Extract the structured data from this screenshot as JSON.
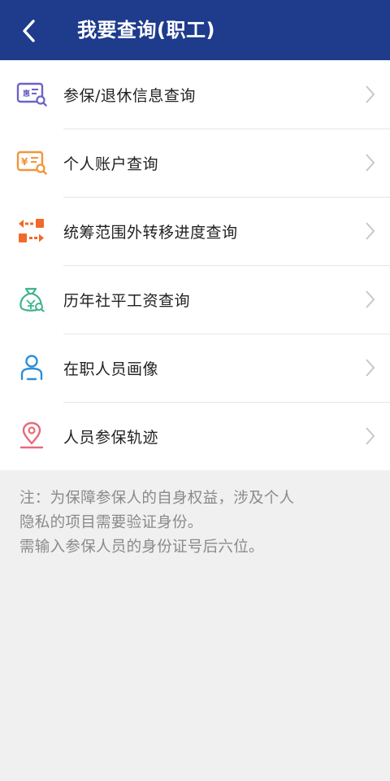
{
  "header": {
    "back_icon": "chevron-left-icon",
    "title": "我要查询(职工)"
  },
  "menu": {
    "items": [
      {
        "label": "参保/退休信息查询",
        "icon": "id-card-search-icon",
        "color": "#6c63c7"
      },
      {
        "label": "个人账户查询",
        "icon": "yuan-document-search-icon",
        "color": "#f0953a"
      },
      {
        "label": "统筹范围外转移进度查询",
        "icon": "transfer-arrows-icon",
        "color": "#f06a2a"
      },
      {
        "label": "历年社平工资查询",
        "icon": "money-bag-icon",
        "color": "#3fb58a"
      },
      {
        "label": "在职人员画像",
        "icon": "person-icon",
        "color": "#2e8fd6"
      },
      {
        "label": "人员参保轨迹",
        "icon": "location-pin-icon",
        "color": "#e86a7a"
      }
    ]
  },
  "note": {
    "line1": "注：为保障参保人的自身权益，涉及个人",
    "line2": "隐私的项目需要验证身份。",
    "line3": "需输入参保人员的身份证号后六位。"
  },
  "colors": {
    "header_bg": "#1e3b8c",
    "chevron": "#c8c8c8",
    "note_text": "#8a8a8a"
  }
}
